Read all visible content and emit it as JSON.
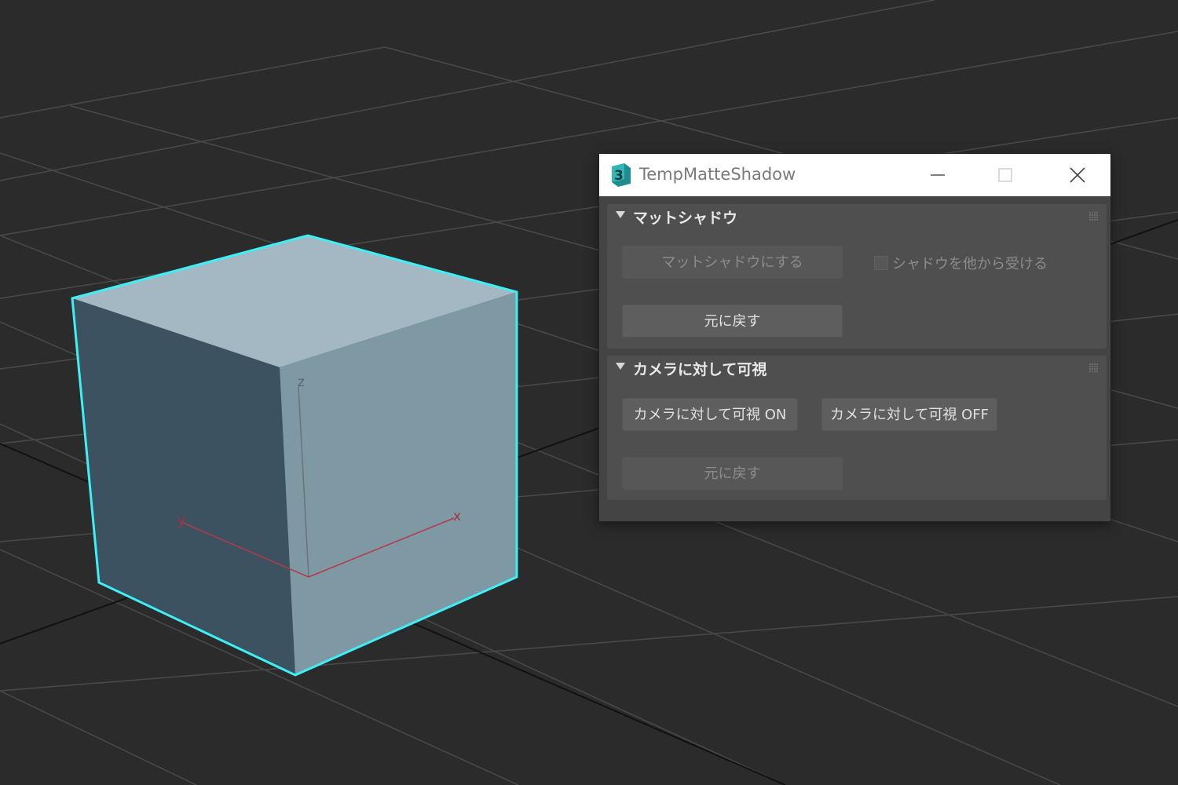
{
  "viewport": {
    "axis_labels": {
      "x": "x",
      "y": "y",
      "z": "z"
    },
    "selection_color": "#3ef0f5",
    "background_color": "#2b2b2b"
  },
  "dialog": {
    "title": "TempMatteShadow",
    "app_icon": "3dsmax-icon",
    "window_buttons": [
      "minimize-icon",
      "maximize-icon",
      "close-icon"
    ]
  },
  "rollouts": [
    {
      "title": "マットシャドウ",
      "make_button": "マットシャドウにする",
      "receive_shadow_label": "シャドウを他から受ける",
      "receive_shadow_checked": false,
      "revert_button": "元に戻す"
    },
    {
      "title": "カメラに対して可視",
      "on_button": "カメラに対して可視 ON",
      "off_button": "カメラに対して可視 OFF",
      "revert_button": "元に戻す"
    }
  ]
}
